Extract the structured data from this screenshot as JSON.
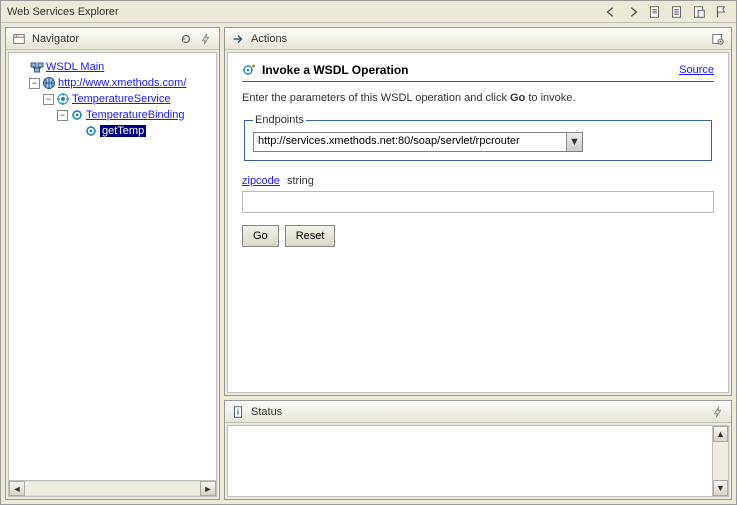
{
  "title": "Web Services Explorer",
  "panels": {
    "navigator": {
      "title": "Navigator"
    },
    "actions": {
      "title": "Actions"
    },
    "status": {
      "title": "Status"
    }
  },
  "tree": {
    "root_label": "WSDL Main",
    "url_label": "http://www.xmethods.com/",
    "service_label": "TemperatureService",
    "binding_label": "TemperatureBinding",
    "operation_label": "getTemp"
  },
  "operation": {
    "heading": "Invoke a WSDL Operation",
    "source_link": "Source",
    "instructions_prefix": "Enter the parameters of this WSDL operation and click ",
    "instructions_bold": "Go",
    "instructions_suffix": " to invoke.",
    "endpoints_legend": "Endpoints",
    "endpoint_selected": "http://services.xmethods.net:80/soap/servlet/rpcrouter",
    "params": [
      {
        "name": "zipcode",
        "type": "string",
        "value": ""
      }
    ],
    "go_label": "Go",
    "reset_label": "Reset"
  }
}
